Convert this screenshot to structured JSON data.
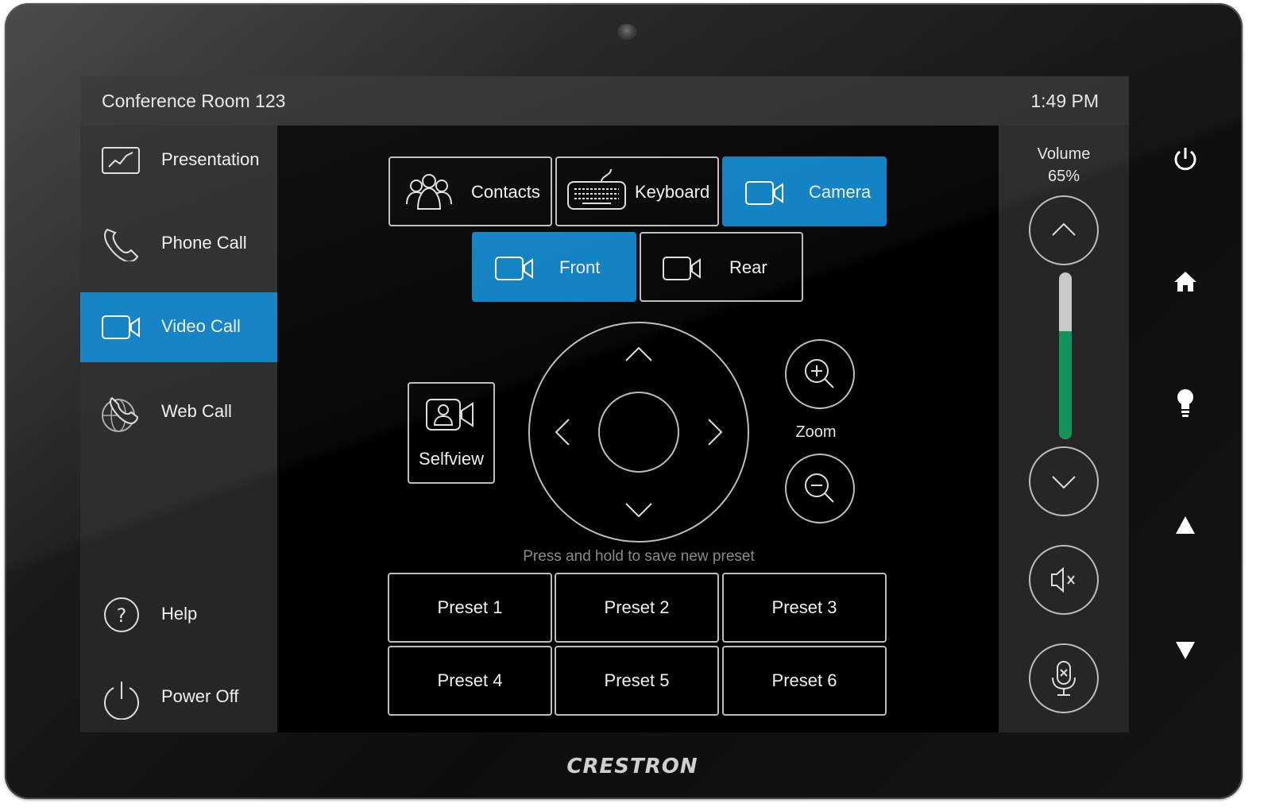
{
  "header": {
    "room_name": "Conference Room 123",
    "time": "1:49 PM"
  },
  "sidebar": {
    "items": [
      {
        "label": "Presentation",
        "icon": "presentation-chart-icon",
        "active": false
      },
      {
        "label": "Phone Call",
        "icon": "phone-icon",
        "active": false
      },
      {
        "label": "Video Call",
        "icon": "video-camera-icon",
        "active": true
      },
      {
        "label": "Web Call",
        "icon": "globe-phone-icon",
        "active": false
      }
    ],
    "bottom_items": [
      {
        "label": "Help",
        "icon": "help-icon"
      },
      {
        "label": "Power Off",
        "icon": "power-icon"
      }
    ]
  },
  "tabs": [
    {
      "label": "Contacts",
      "icon": "contacts-icon",
      "active": false
    },
    {
      "label": "Keyboard",
      "icon": "keyboard-icon",
      "active": false
    },
    {
      "label": "Camera",
      "icon": "video-camera-icon",
      "active": true
    }
  ],
  "camera_select": [
    {
      "label": "Front",
      "icon": "video-camera-icon",
      "active": true
    },
    {
      "label": "Rear",
      "icon": "video-camera-icon",
      "active": false
    }
  ],
  "selfview": {
    "label": "Selfview",
    "icon": "selfview-icon"
  },
  "zoom": {
    "label": "Zoom"
  },
  "presets": {
    "hint": "Press and hold to save new preset",
    "items": [
      "Preset 1",
      "Preset 2",
      "Preset 3",
      "Preset 4",
      "Preset 5",
      "Preset 6"
    ]
  },
  "volume": {
    "label": "Volume",
    "percent_text": "65%",
    "level": 0.65
  },
  "brand": "CRESTRON",
  "colors": {
    "accent": "#0a7ec2",
    "volume_fill": "#13925c",
    "panel": "#262626"
  }
}
